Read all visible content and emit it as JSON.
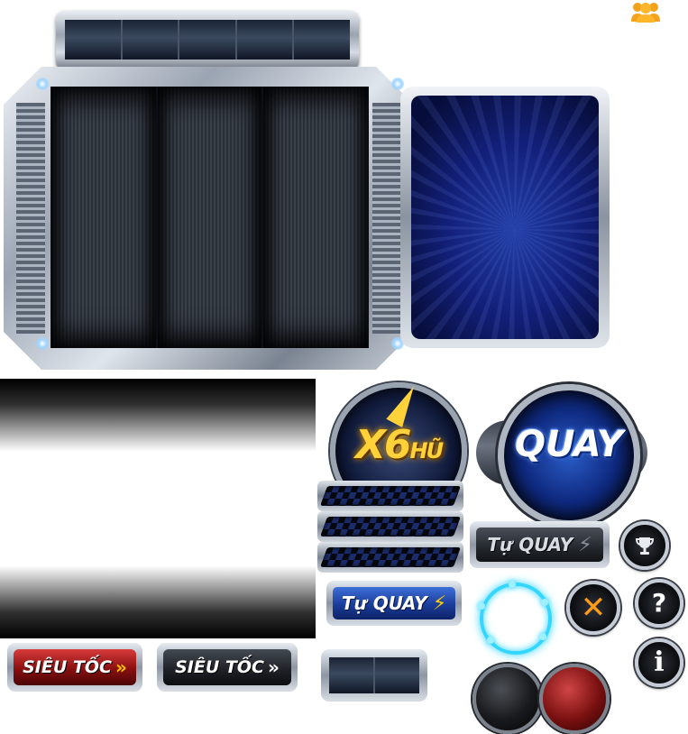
{
  "logo": {
    "main": "X6",
    "suffix": "HŨ"
  },
  "buttons": {
    "spin": "QUAY",
    "auto_spin_blue": "Tự QUAY",
    "auto_spin_gray": "Tự QUAY",
    "turbo_red": "SIÊU TỐC",
    "turbo_dark": "SIÊU TỐC",
    "help_glyph": "?",
    "info_glyph": "i",
    "close_glyph": "✕"
  },
  "icons": {
    "users": "users-icon",
    "trophy": "trophy-icon",
    "help": "question-icon",
    "info": "info-icon",
    "close": "close-icon",
    "bolt": "lightning-bolt-icon",
    "chevrons": "double-chevron-icon"
  },
  "colors": {
    "accent_blue": "#1a3c9a",
    "accent_gold": "#ffd23a",
    "turbo_red": "#8a1010",
    "glow_cyan": "#33d6ff",
    "close_orange": "#ff9b1a"
  }
}
